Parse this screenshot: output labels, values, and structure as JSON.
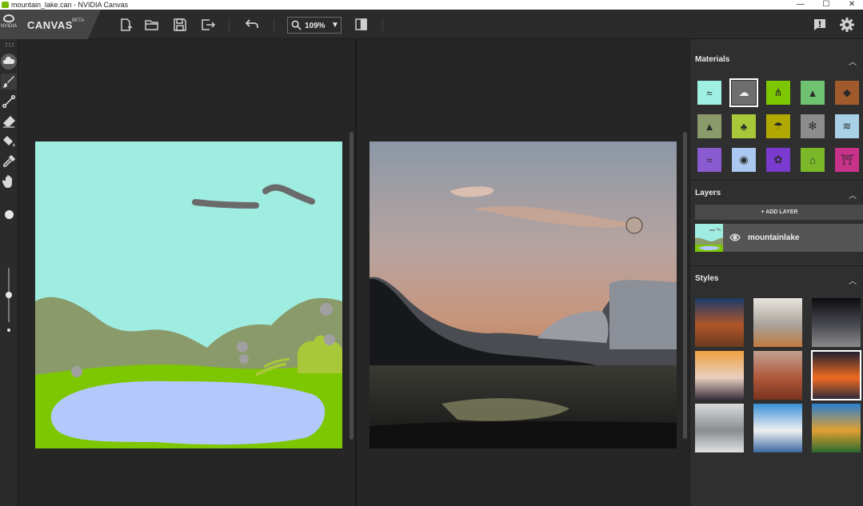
{
  "window": {
    "title": "mountain_lake.can - NVIDIA Canvas",
    "controls": {
      "minimize": "—",
      "maximize": "☐",
      "close": "✕"
    }
  },
  "brand": {
    "logo_text": "NVIDIA",
    "name": "CANVAS",
    "badge": "BETA"
  },
  "toolbar": {
    "zoom_value": "109%",
    "zoom_arrow": "▼",
    "buttons": [
      "new-file-icon",
      "open-folder-icon",
      "save-icon",
      "export-icon",
      "undo-icon",
      "compare-icon",
      "feedback-icon",
      "gear-icon"
    ]
  },
  "tools": {
    "items": [
      "material-cloud-icon",
      "brush-icon",
      "line-icon",
      "eraser-icon",
      "fill-icon",
      "eyedropper-icon",
      "hand-icon"
    ],
    "active": "brush-icon",
    "brush_size_fraction": 0.5
  },
  "panel": {
    "materials": {
      "title": "Materials",
      "caret": "︿",
      "items": [
        {
          "name": "water",
          "color": "#9ff0e2",
          "selected": false
        },
        {
          "name": "cloud",
          "color": "#6e6e6e",
          "selected": true
        },
        {
          "name": "grass",
          "color": "#7dc700",
          "selected": false
        },
        {
          "name": "hill",
          "color": "#6fc26f",
          "selected": false
        },
        {
          "name": "rock",
          "color": "#a05a2c",
          "selected": false
        },
        {
          "name": "mountain",
          "color": "#8a9a6a",
          "selected": false
        },
        {
          "name": "tree",
          "color": "#a8c83a",
          "selected": false
        },
        {
          "name": "bush",
          "color": "#b0a800",
          "selected": false
        },
        {
          "name": "snow",
          "color": "#8c8c8c",
          "selected": false
        },
        {
          "name": "sea",
          "color": "#a8d0e6",
          "selected": false
        },
        {
          "name": "fog",
          "color": "#8a5ad0",
          "selected": false
        },
        {
          "name": "lake",
          "color": "#aac8f0",
          "selected": false
        },
        {
          "name": "flowers",
          "color": "#7a3ad0",
          "selected": false
        },
        {
          "name": "hut",
          "color": "#7ab82a",
          "selected": false
        },
        {
          "name": "bridge",
          "color": "#c8328a",
          "selected": false
        }
      ]
    },
    "layers": {
      "title": "Layers",
      "caret": "︿",
      "add_label": "+ ADD LAYER",
      "items": [
        {
          "name": "mountainlake"
        }
      ]
    },
    "styles": {
      "title": "Styles",
      "caret": "︿",
      "selected_index": 5
    }
  },
  "colors": {
    "sky": "#9fece0",
    "mountain": "#8a9a6a",
    "grass": "#7dc700",
    "lake": "#b3c8fc",
    "cloud_stroke": "#6a6a6a",
    "tree": "#a8c83a",
    "snow": "#a0a0a0",
    "accent": "#76b900"
  }
}
